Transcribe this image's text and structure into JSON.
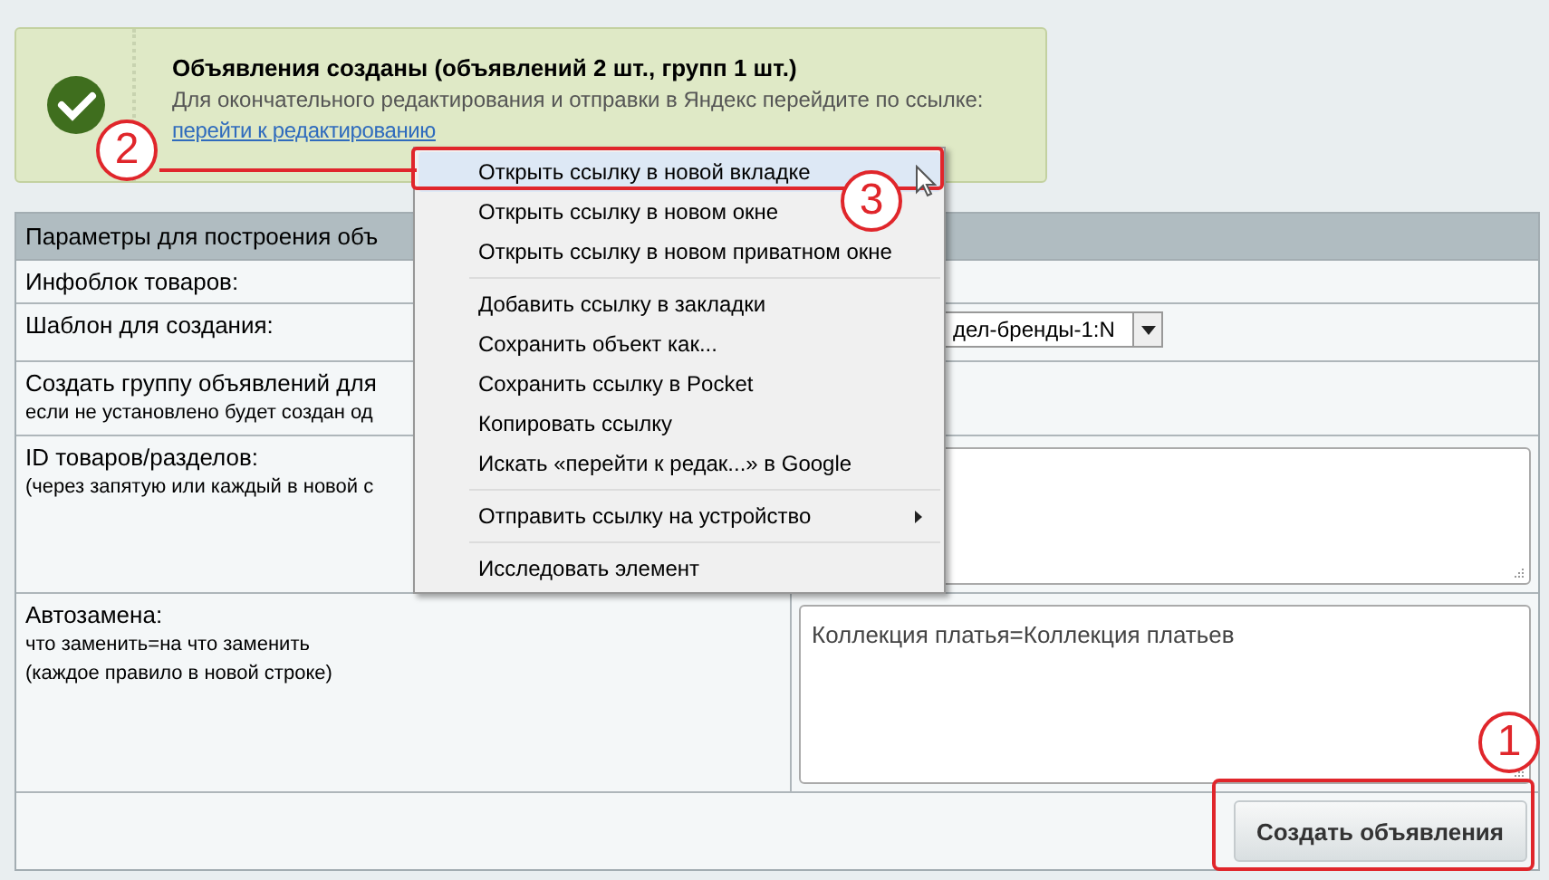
{
  "notice": {
    "title": "Объявления созданы (объявлений 2 шт., групп 1 шт.)",
    "text": "Для окончательного редактирования и отправки в Яндекс перейдите по ссылке:",
    "link": "перейти к редактированию"
  },
  "table": {
    "header": "Параметры для построения объ",
    "rows": [
      {
        "label": "Инфоблок товаров:"
      },
      {
        "label": "Шаблон для создания:",
        "kind": "select",
        "value": "дел-бренды-1:N"
      },
      {
        "label": "Создать группу объявлений для",
        "hint": "если не установлено будет создан од"
      },
      {
        "label": "ID товаров/разделов:",
        "hint": "(через запятую или каждый в новой с",
        "kind": "textarea"
      },
      {
        "label": "Автозамена:",
        "hint": "что заменить=на что заменить",
        "hint2": "(каждое правило в новой строке)",
        "kind": "textarea",
        "value": "Коллекция платья=Коллекция платьев"
      }
    ],
    "button": "Создать объявления"
  },
  "context_menu": [
    {
      "kind": "item",
      "label": "Открыть ссылку в новой вкладке",
      "selected": true
    },
    {
      "kind": "item",
      "label": "Открыть ссылку в новом окне",
      "selected": false
    },
    {
      "kind": "item",
      "label": "Открыть ссылку в новом приватном окне",
      "selected": false
    },
    {
      "kind": "separator"
    },
    {
      "kind": "item",
      "label": "Добавить ссылку в закладки",
      "selected": false
    },
    {
      "kind": "item",
      "label": "Сохранить объект как...",
      "selected": false
    },
    {
      "kind": "item",
      "label": "Сохранить ссылку в Pocket",
      "selected": false
    },
    {
      "kind": "item",
      "label": "Копировать ссылку",
      "selected": false
    },
    {
      "kind": "item",
      "label": "Искать «перейти к редак...» в Google",
      "selected": false
    },
    {
      "kind": "separator"
    },
    {
      "kind": "submenu",
      "label": "Отправить ссылку на устройство",
      "selected": false
    },
    {
      "kind": "separator"
    },
    {
      "kind": "item",
      "label": "Исследовать элемент",
      "selected": false
    }
  ],
  "annotations": [
    "2",
    "3",
    "1"
  ]
}
